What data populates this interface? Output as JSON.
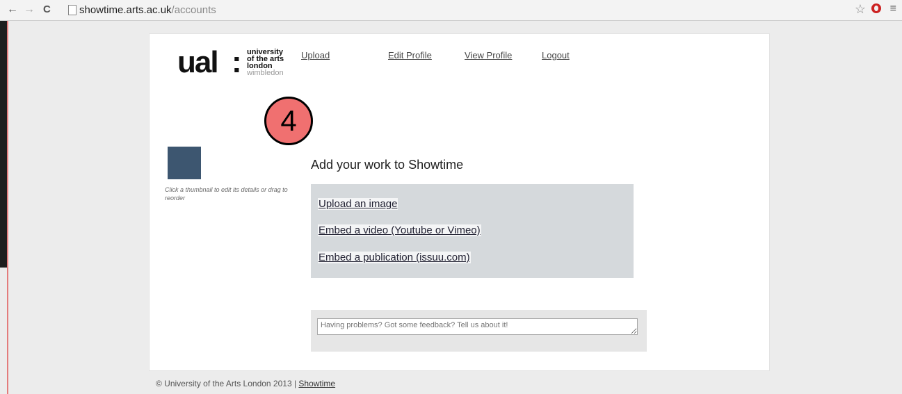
{
  "browser": {
    "url_host": "showtime.arts.ac.uk",
    "url_path": "/accounts",
    "back_icon": "←",
    "forward_icon": "→",
    "reload_icon": "C",
    "star_icon": "☆",
    "menu_icon": "≡"
  },
  "logo": {
    "ual": "ual",
    "colon": ":",
    "line1": "university",
    "line2": "of the arts",
    "line3": "london",
    "line4": "wimbledon"
  },
  "nav": {
    "upload": "Upload",
    "edit_profile": "Edit Profile",
    "view_profile": "View Profile",
    "logout": "Logout"
  },
  "badge": {
    "number": "4",
    "color": "#f07070"
  },
  "thumbnail": {
    "color": "#3d5670",
    "hint": "Click a thumbnail to edit its details or drag to reorder"
  },
  "add_work": {
    "title": "Add your work to Showtime",
    "upload_image": "Upload an image",
    "embed_video": "Embed a video (Youtube or Vimeo)",
    "embed_publication": "Embed a publication (issuu.com)"
  },
  "feedback": {
    "placeholder": "Having problems? Got some feedback? Tell us about it!"
  },
  "footer": {
    "copyright": "© University of the Arts London 2013 | ",
    "link": "Showtime"
  }
}
